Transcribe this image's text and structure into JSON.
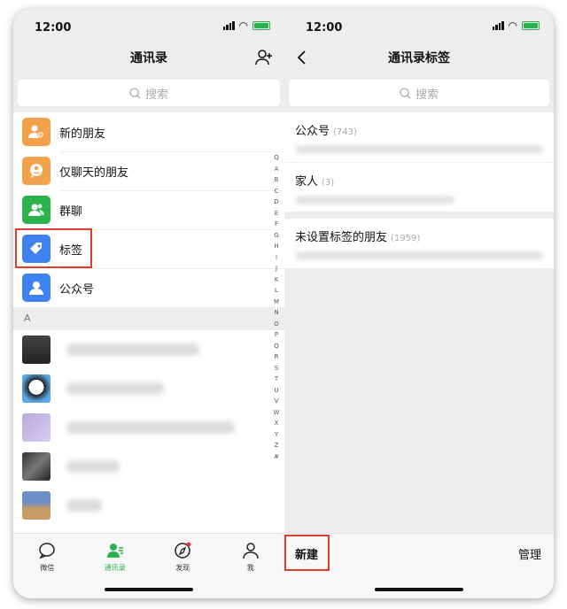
{
  "colors": {
    "accent": "#2bb24c",
    "highlight": "#e23b2e"
  },
  "left": {
    "status_time": "12:00",
    "title": "通讯录",
    "search_placeholder": "搜索",
    "menu": [
      {
        "label": "新的朋友",
        "icon": "add-friend-icon",
        "color": "#f5a14b"
      },
      {
        "label": "仅聊天的朋友",
        "icon": "chat-only-friend-icon",
        "color": "#f5a14b"
      },
      {
        "label": "群聊",
        "icon": "group-chat-icon",
        "color": "#2bb24c"
      },
      {
        "label": "标签",
        "icon": "tag-icon",
        "color": "#3d82f0"
      },
      {
        "label": "公众号",
        "icon": "official-account-icon",
        "color": "#3d82f0"
      }
    ],
    "section_letter": "A",
    "alphabet": [
      "Q",
      "A",
      "B",
      "C",
      "D",
      "E",
      "F",
      "G",
      "H",
      "I",
      "J",
      "K",
      "L",
      "M",
      "N",
      "O",
      "P",
      "Q",
      "R",
      "S",
      "T",
      "U",
      "V",
      "W",
      "X",
      "Y",
      "Z",
      "#"
    ],
    "tabs": [
      {
        "label": "微信",
        "icon": "chat-bubble-icon",
        "active": false
      },
      {
        "label": "通讯录",
        "icon": "contacts-icon",
        "active": true
      },
      {
        "label": "发现",
        "icon": "compass-icon",
        "active": false
      },
      {
        "label": "我",
        "icon": "person-icon",
        "active": false
      }
    ]
  },
  "right": {
    "status_time": "12:00",
    "title": "通讯录标签",
    "search_placeholder": "搜索",
    "tags": [
      {
        "name": "公众号",
        "count": "(743)"
      },
      {
        "name": "家人",
        "count": "(3)"
      },
      {
        "name": "未设置标签的朋友",
        "count": "(1959)"
      }
    ],
    "new_label": "新建",
    "manage_label": "管理"
  }
}
